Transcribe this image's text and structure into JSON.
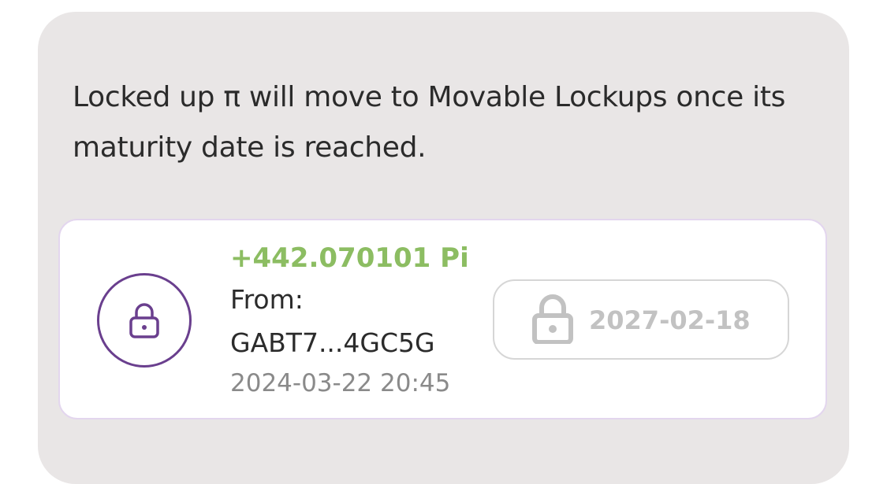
{
  "info": {
    "text": "Locked up π will move to Movable Lockups once its maturity date is reached."
  },
  "lockup": {
    "amount": "+442.070101 Pi",
    "from_label": "From:",
    "from_address": "GABT7...4GC5G",
    "timestamp": "2024-03-22 20:45",
    "maturity_date": "2027-02-18"
  },
  "icons": {
    "badge": "lock-icon",
    "maturity": "lock-icon"
  },
  "colors": {
    "panel_bg": "#e9e6e6",
    "accent_purple": "#6a3f8e",
    "amount_green": "#8cbd62",
    "muted_gray": "#c2c2c2"
  }
}
